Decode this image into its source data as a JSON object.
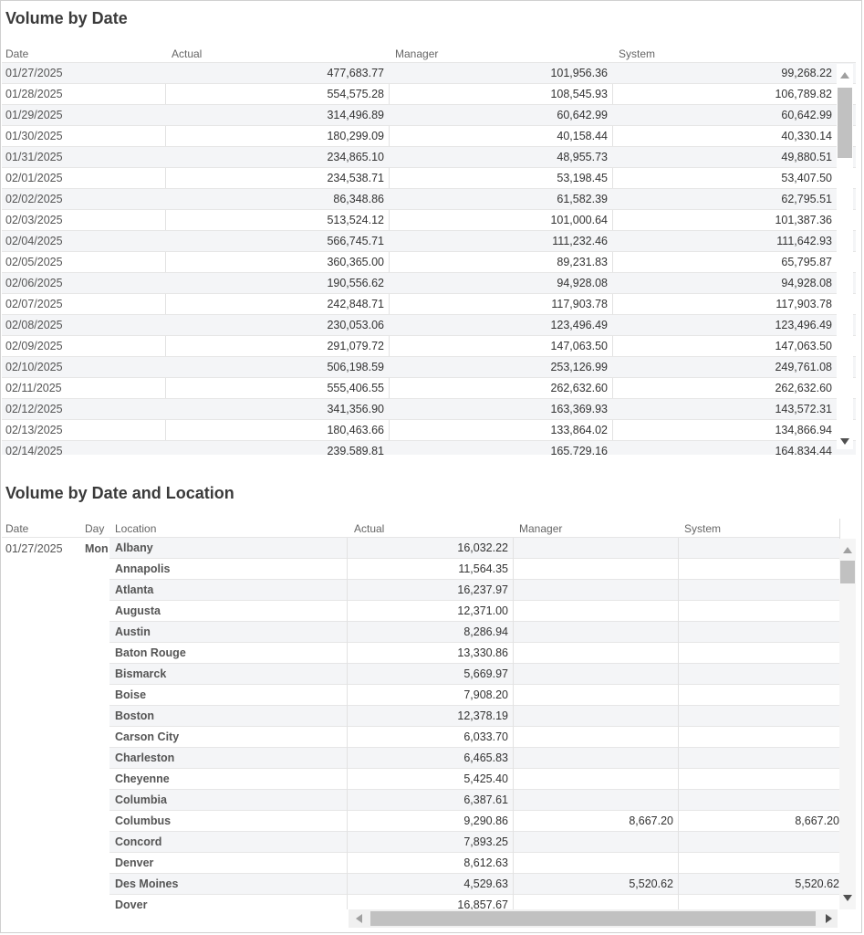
{
  "panel1": {
    "title": "Volume by Date",
    "columns": [
      "Date",
      "Actual",
      "Manager",
      "System"
    ],
    "rows": [
      [
        "01/27/2025",
        "477,683.77",
        "101,956.36",
        "99,268.22"
      ],
      [
        "01/28/2025",
        "554,575.28",
        "108,545.93",
        "106,789.82"
      ],
      [
        "01/29/2025",
        "314,496.89",
        "60,642.99",
        "60,642.99"
      ],
      [
        "01/30/2025",
        "180,299.09",
        "40,158.44",
        "40,330.14"
      ],
      [
        "01/31/2025",
        "234,865.10",
        "48,955.73",
        "49,880.51"
      ],
      [
        "02/01/2025",
        "234,538.71",
        "53,198.45",
        "53,407.50"
      ],
      [
        "02/02/2025",
        "86,348.86",
        "61,582.39",
        "62,795.51"
      ],
      [
        "02/03/2025",
        "513,524.12",
        "101,000.64",
        "101,387.36"
      ],
      [
        "02/04/2025",
        "566,745.71",
        "111,232.46",
        "111,642.93"
      ],
      [
        "02/05/2025",
        "360,365.00",
        "89,231.83",
        "65,795.87"
      ],
      [
        "02/06/2025",
        "190,556.62",
        "94,928.08",
        "94,928.08"
      ],
      [
        "02/07/2025",
        "242,848.71",
        "117,903.78",
        "117,903.78"
      ],
      [
        "02/08/2025",
        "230,053.06",
        "123,496.49",
        "123,496.49"
      ],
      [
        "02/09/2025",
        "291,079.72",
        "147,063.50",
        "147,063.50"
      ],
      [
        "02/10/2025",
        "506,198.59",
        "253,126.99",
        "249,761.08"
      ],
      [
        "02/11/2025",
        "555,406.55",
        "262,632.60",
        "262,632.60"
      ],
      [
        "02/12/2025",
        "341,356.90",
        "163,369.93",
        "143,572.31"
      ],
      [
        "02/13/2025",
        "180,463.66",
        "133,864.02",
        "134,866.94"
      ],
      [
        "02/14/2025",
        "239,589.81",
        "165,729.16",
        "164,834.44"
      ]
    ]
  },
  "panel2": {
    "title": "Volume by Date and Location",
    "columns": [
      "Date",
      "Day",
      "Location",
      "Actual",
      "Manager",
      "System"
    ],
    "group": {
      "date": "01/27/2025",
      "day": "Mon"
    },
    "rows": [
      [
        "Albany",
        "16,032.22",
        "",
        ""
      ],
      [
        "Annapolis",
        "11,564.35",
        "",
        ""
      ],
      [
        "Atlanta",
        "16,237.97",
        "",
        ""
      ],
      [
        "Augusta",
        "12,371.00",
        "",
        ""
      ],
      [
        "Austin",
        "8,286.94",
        "",
        ""
      ],
      [
        "Baton Rouge",
        "13,330.86",
        "",
        ""
      ],
      [
        "Bismarck",
        "5,669.97",
        "",
        ""
      ],
      [
        "Boise",
        "7,908.20",
        "",
        ""
      ],
      [
        "Boston",
        "12,378.19",
        "",
        ""
      ],
      [
        "Carson City",
        "6,033.70",
        "",
        ""
      ],
      [
        "Charleston",
        "6,465.83",
        "",
        ""
      ],
      [
        "Cheyenne",
        "5,425.40",
        "",
        ""
      ],
      [
        "Columbia",
        "6,387.61",
        "",
        ""
      ],
      [
        "Columbus",
        "9,290.86",
        "8,667.20",
        "8,667.20"
      ],
      [
        "Concord",
        "7,893.25",
        "",
        ""
      ],
      [
        "Denver",
        "8,612.63",
        "",
        ""
      ],
      [
        "Des Moines",
        "4,529.63",
        "5,520.62",
        "5,520.62"
      ],
      [
        "Dover",
        "16,857.67",
        "",
        ""
      ]
    ]
  }
}
